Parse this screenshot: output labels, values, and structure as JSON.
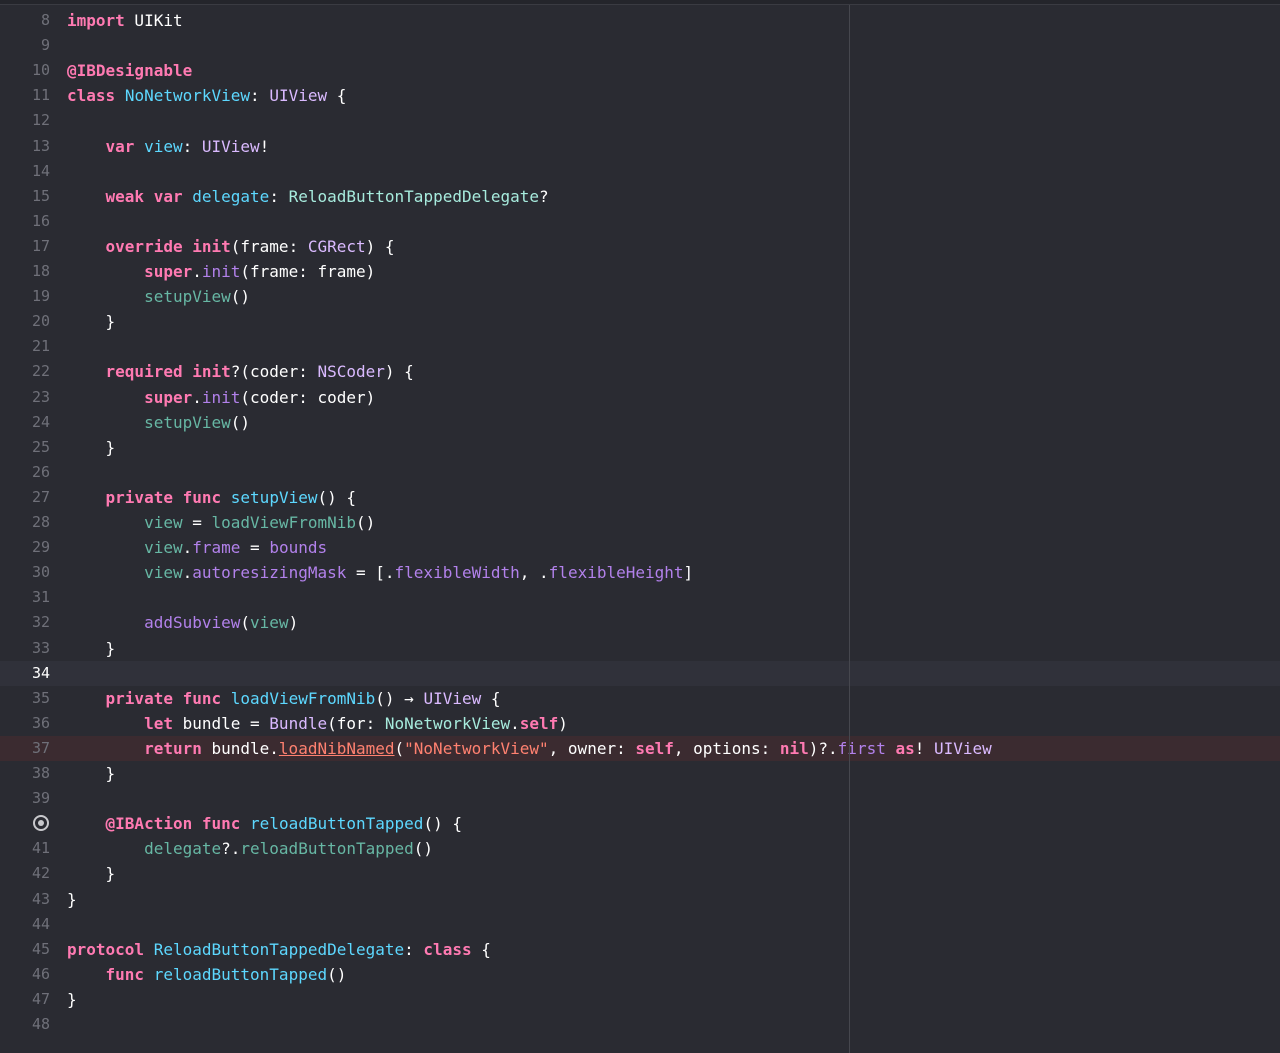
{
  "editor": {
    "file_lines": [
      {
        "no": "8",
        "cur": false,
        "err": false,
        "bp": false,
        "tokens": [
          {
            "c": "kw",
            "t": "import"
          },
          {
            "c": "p",
            "t": " UIKit"
          }
        ]
      },
      {
        "no": "9",
        "cur": false,
        "err": false,
        "bp": false,
        "tokens": []
      },
      {
        "no": "10",
        "cur": false,
        "err": false,
        "bp": false,
        "tokens": [
          {
            "c": "kw",
            "t": "@IBDesignable"
          }
        ]
      },
      {
        "no": "11",
        "cur": false,
        "err": false,
        "bp": false,
        "tokens": [
          {
            "c": "kw",
            "t": "class"
          },
          {
            "c": "p",
            "t": " "
          },
          {
            "c": "decl",
            "t": "NoNetworkView"
          },
          {
            "c": "p",
            "t": ": "
          },
          {
            "c": "ty",
            "t": "UIView"
          },
          {
            "c": "p",
            "t": " {"
          }
        ]
      },
      {
        "no": "12",
        "cur": false,
        "err": false,
        "bp": false,
        "tokens": []
      },
      {
        "no": "13",
        "cur": false,
        "err": false,
        "bp": false,
        "tokens": [
          {
            "c": "p",
            "t": "    "
          },
          {
            "c": "kw",
            "t": "var"
          },
          {
            "c": "p",
            "t": " "
          },
          {
            "c": "decl",
            "t": "view"
          },
          {
            "c": "p",
            "t": ": "
          },
          {
            "c": "ty",
            "t": "UIView"
          },
          {
            "c": "p",
            "t": "!"
          }
        ]
      },
      {
        "no": "14",
        "cur": false,
        "err": false,
        "bp": false,
        "tokens": []
      },
      {
        "no": "15",
        "cur": false,
        "err": false,
        "bp": false,
        "tokens": [
          {
            "c": "p",
            "t": "    "
          },
          {
            "c": "kw",
            "t": "weak"
          },
          {
            "c": "p",
            "t": " "
          },
          {
            "c": "kw",
            "t": "var"
          },
          {
            "c": "p",
            "t": " "
          },
          {
            "c": "decl",
            "t": "delegate"
          },
          {
            "c": "p",
            "t": ": "
          },
          {
            "c": "prj",
            "t": "ReloadButtonTappedDelegate"
          },
          {
            "c": "p",
            "t": "?"
          }
        ]
      },
      {
        "no": "16",
        "cur": false,
        "err": false,
        "bp": false,
        "tokens": []
      },
      {
        "no": "17",
        "cur": false,
        "err": false,
        "bp": false,
        "tokens": [
          {
            "c": "p",
            "t": "    "
          },
          {
            "c": "kw",
            "t": "override"
          },
          {
            "c": "p",
            "t": " "
          },
          {
            "c": "kw",
            "t": "init"
          },
          {
            "c": "p",
            "t": "(frame: "
          },
          {
            "c": "ty",
            "t": "CGRect"
          },
          {
            "c": "p",
            "t": ") {"
          }
        ]
      },
      {
        "no": "18",
        "cur": false,
        "err": false,
        "bp": false,
        "tokens": [
          {
            "c": "p",
            "t": "        "
          },
          {
            "c": "kw",
            "t": "super"
          },
          {
            "c": "p",
            "t": "."
          },
          {
            "c": "id",
            "t": "init"
          },
          {
            "c": "p",
            "t": "(frame: frame)"
          }
        ]
      },
      {
        "no": "19",
        "cur": false,
        "err": false,
        "bp": false,
        "tokens": [
          {
            "c": "p",
            "t": "        "
          },
          {
            "c": "fn",
            "t": "setupView"
          },
          {
            "c": "p",
            "t": "()"
          }
        ]
      },
      {
        "no": "20",
        "cur": false,
        "err": false,
        "bp": false,
        "tokens": [
          {
            "c": "p",
            "t": "    }"
          }
        ]
      },
      {
        "no": "21",
        "cur": false,
        "err": false,
        "bp": false,
        "tokens": []
      },
      {
        "no": "22",
        "cur": false,
        "err": false,
        "bp": false,
        "tokens": [
          {
            "c": "p",
            "t": "    "
          },
          {
            "c": "kw",
            "t": "required"
          },
          {
            "c": "p",
            "t": " "
          },
          {
            "c": "kw",
            "t": "init"
          },
          {
            "c": "p",
            "t": "?(coder: "
          },
          {
            "c": "ty",
            "t": "NSCoder"
          },
          {
            "c": "p",
            "t": ") {"
          }
        ]
      },
      {
        "no": "23",
        "cur": false,
        "err": false,
        "bp": false,
        "tokens": [
          {
            "c": "p",
            "t": "        "
          },
          {
            "c": "kw",
            "t": "super"
          },
          {
            "c": "p",
            "t": "."
          },
          {
            "c": "id",
            "t": "init"
          },
          {
            "c": "p",
            "t": "(coder: coder)"
          }
        ]
      },
      {
        "no": "24",
        "cur": false,
        "err": false,
        "bp": false,
        "tokens": [
          {
            "c": "p",
            "t": "        "
          },
          {
            "c": "fn",
            "t": "setupView"
          },
          {
            "c": "p",
            "t": "()"
          }
        ]
      },
      {
        "no": "25",
        "cur": false,
        "err": false,
        "bp": false,
        "tokens": [
          {
            "c": "p",
            "t": "    }"
          }
        ]
      },
      {
        "no": "26",
        "cur": false,
        "err": false,
        "bp": false,
        "tokens": []
      },
      {
        "no": "27",
        "cur": false,
        "err": false,
        "bp": false,
        "tokens": [
          {
            "c": "p",
            "t": "    "
          },
          {
            "c": "kw",
            "t": "private"
          },
          {
            "c": "p",
            "t": " "
          },
          {
            "c": "kw",
            "t": "func"
          },
          {
            "c": "p",
            "t": " "
          },
          {
            "c": "decl",
            "t": "setupView"
          },
          {
            "c": "p",
            "t": "() {"
          }
        ]
      },
      {
        "no": "28",
        "cur": false,
        "err": false,
        "bp": false,
        "tokens": [
          {
            "c": "p",
            "t": "        "
          },
          {
            "c": "fn",
            "t": "view"
          },
          {
            "c": "p",
            "t": " = "
          },
          {
            "c": "fn",
            "t": "loadViewFromNib"
          },
          {
            "c": "p",
            "t": "()"
          }
        ]
      },
      {
        "no": "29",
        "cur": false,
        "err": false,
        "bp": false,
        "tokens": [
          {
            "c": "p",
            "t": "        "
          },
          {
            "c": "fn",
            "t": "view"
          },
          {
            "c": "p",
            "t": "."
          },
          {
            "c": "id",
            "t": "frame"
          },
          {
            "c": "p",
            "t": " = "
          },
          {
            "c": "id",
            "t": "bounds"
          }
        ]
      },
      {
        "no": "30",
        "cur": false,
        "err": false,
        "bp": false,
        "tokens": [
          {
            "c": "p",
            "t": "        "
          },
          {
            "c": "fn",
            "t": "view"
          },
          {
            "c": "p",
            "t": "."
          },
          {
            "c": "id",
            "t": "autoresizingMask"
          },
          {
            "c": "p",
            "t": " = [."
          },
          {
            "c": "id",
            "t": "flexibleWidth"
          },
          {
            "c": "p",
            "t": ", ."
          },
          {
            "c": "id",
            "t": "flexibleHeight"
          },
          {
            "c": "p",
            "t": "]"
          }
        ]
      },
      {
        "no": "31",
        "cur": false,
        "err": false,
        "bp": false,
        "tokens": []
      },
      {
        "no": "32",
        "cur": false,
        "err": false,
        "bp": false,
        "tokens": [
          {
            "c": "p",
            "t": "        "
          },
          {
            "c": "id",
            "t": "addSubview"
          },
          {
            "c": "p",
            "t": "("
          },
          {
            "c": "fn",
            "t": "view"
          },
          {
            "c": "p",
            "t": ")"
          }
        ]
      },
      {
        "no": "33",
        "cur": false,
        "err": false,
        "bp": false,
        "tokens": [
          {
            "c": "p",
            "t": "    }"
          }
        ]
      },
      {
        "no": "34",
        "cur": true,
        "err": false,
        "bp": false,
        "tokens": []
      },
      {
        "no": "35",
        "cur": false,
        "err": false,
        "bp": false,
        "tokens": [
          {
            "c": "p",
            "t": "    "
          },
          {
            "c": "kw",
            "t": "private"
          },
          {
            "c": "p",
            "t": " "
          },
          {
            "c": "kw",
            "t": "func"
          },
          {
            "c": "p",
            "t": " "
          },
          {
            "c": "decl",
            "t": "loadViewFromNib"
          },
          {
            "c": "p",
            "t": "() → "
          },
          {
            "c": "ty",
            "t": "UIView"
          },
          {
            "c": "p",
            "t": " {"
          }
        ]
      },
      {
        "no": "36",
        "cur": false,
        "err": false,
        "bp": false,
        "tokens": [
          {
            "c": "p",
            "t": "        "
          },
          {
            "c": "kw",
            "t": "let"
          },
          {
            "c": "p",
            "t": " bundle = "
          },
          {
            "c": "ty",
            "t": "Bundle"
          },
          {
            "c": "p",
            "t": "(for: "
          },
          {
            "c": "prj",
            "t": "NoNetworkView"
          },
          {
            "c": "p",
            "t": "."
          },
          {
            "c": "kw",
            "t": "self"
          },
          {
            "c": "p",
            "t": ")"
          }
        ]
      },
      {
        "no": "37",
        "cur": false,
        "err": true,
        "bp": false,
        "tokens": [
          {
            "c": "p",
            "t": "        "
          },
          {
            "c": "kw",
            "t": "return"
          },
          {
            "c": "p",
            "t": " bundle."
          },
          {
            "c": "link",
            "t": "loadNibNamed"
          },
          {
            "c": "p",
            "t": "("
          },
          {
            "c": "str",
            "t": "\"NoNetworkView\""
          },
          {
            "c": "p",
            "t": ", owner: "
          },
          {
            "c": "kw",
            "t": "self"
          },
          {
            "c": "p",
            "t": ", options: "
          },
          {
            "c": "kw",
            "t": "nil"
          },
          {
            "c": "p",
            "t": ")?."
          },
          {
            "c": "id",
            "t": "first"
          },
          {
            "c": "p",
            "t": " "
          },
          {
            "c": "kw",
            "t": "as"
          },
          {
            "c": "p",
            "t": "! "
          },
          {
            "c": "ty",
            "t": "UIView"
          }
        ]
      },
      {
        "no": "38",
        "cur": false,
        "err": false,
        "bp": false,
        "tokens": [
          {
            "c": "p",
            "t": "    }"
          }
        ]
      },
      {
        "no": "39",
        "cur": false,
        "err": false,
        "bp": false,
        "tokens": []
      },
      {
        "no": "",
        "cur": false,
        "err": false,
        "bp": true,
        "tokens": [
          {
            "c": "p",
            "t": "    "
          },
          {
            "c": "kw",
            "t": "@IBAction"
          },
          {
            "c": "p",
            "t": " "
          },
          {
            "c": "kw",
            "t": "func"
          },
          {
            "c": "p",
            "t": " "
          },
          {
            "c": "decl",
            "t": "reloadButtonTapped"
          },
          {
            "c": "p",
            "t": "() {"
          }
        ]
      },
      {
        "no": "41",
        "cur": false,
        "err": false,
        "bp": false,
        "tokens": [
          {
            "c": "p",
            "t": "        "
          },
          {
            "c": "fn",
            "t": "delegate"
          },
          {
            "c": "p",
            "t": "?."
          },
          {
            "c": "fn",
            "t": "reloadButtonTapped"
          },
          {
            "c": "p",
            "t": "()"
          }
        ]
      },
      {
        "no": "42",
        "cur": false,
        "err": false,
        "bp": false,
        "tokens": [
          {
            "c": "p",
            "t": "    }"
          }
        ]
      },
      {
        "no": "43",
        "cur": false,
        "err": false,
        "bp": false,
        "tokens": [
          {
            "c": "p",
            "t": "}"
          }
        ]
      },
      {
        "no": "44",
        "cur": false,
        "err": false,
        "bp": false,
        "tokens": []
      },
      {
        "no": "45",
        "cur": false,
        "err": false,
        "bp": false,
        "tokens": [
          {
            "c": "kw",
            "t": "protocol"
          },
          {
            "c": "p",
            "t": " "
          },
          {
            "c": "decl",
            "t": "ReloadButtonTappedDelegate"
          },
          {
            "c": "p",
            "t": ": "
          },
          {
            "c": "kw",
            "t": "class"
          },
          {
            "c": "p",
            "t": " {"
          }
        ]
      },
      {
        "no": "46",
        "cur": false,
        "err": false,
        "bp": false,
        "tokens": [
          {
            "c": "p",
            "t": "    "
          },
          {
            "c": "kw",
            "t": "func"
          },
          {
            "c": "p",
            "t": " "
          },
          {
            "c": "decl",
            "t": "reloadButtonTapped"
          },
          {
            "c": "p",
            "t": "()"
          }
        ]
      },
      {
        "no": "47",
        "cur": false,
        "err": false,
        "bp": false,
        "tokens": [
          {
            "c": "p",
            "t": "}"
          }
        ]
      },
      {
        "no": "48",
        "cur": false,
        "err": false,
        "bp": false,
        "tokens": []
      }
    ]
  },
  "colors": {
    "background": "#2a2b32",
    "keyword": "#ff7ab2",
    "type": "#dabaff",
    "declaration": "#5dd8ff",
    "project_type": "#a7ebdd",
    "member": "#b281eb",
    "project_function": "#67b7a4",
    "string": "#ff8170",
    "current_line": "#30313a",
    "error_line": "#3b2b30"
  }
}
